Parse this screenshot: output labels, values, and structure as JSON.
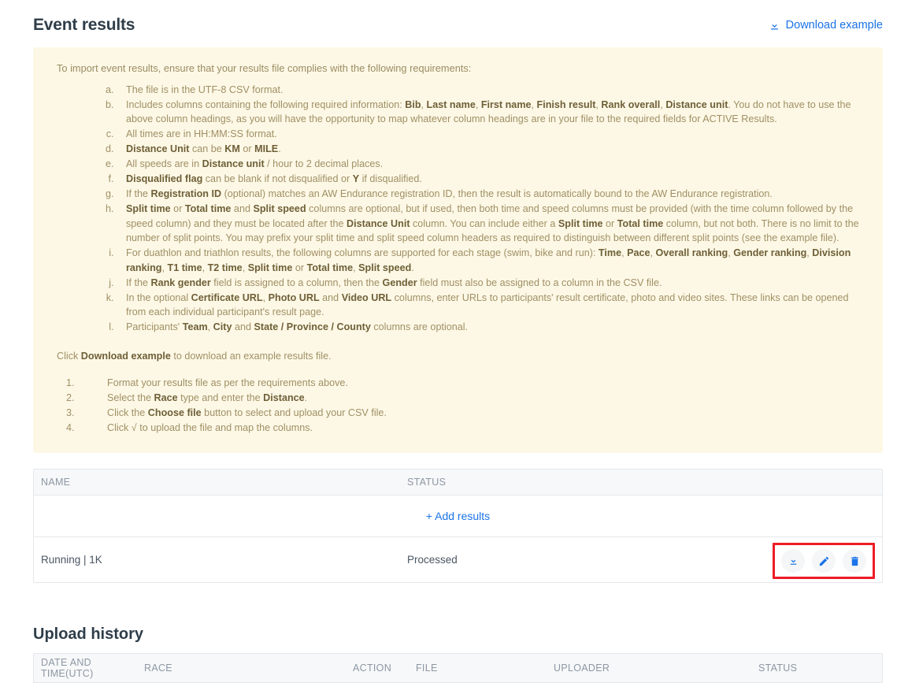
{
  "header": {
    "title": "Event results",
    "download_example_label": "Download example",
    "download_icon": "download-icon",
    "link_color": "#1a73e8"
  },
  "info_box": {
    "background_color": "#fdf8e6",
    "text_color": "#a08f64",
    "lead": "To import event results, ensure that your results file complies with the following requirements:",
    "requirements": [
      [
        {
          "t": "The file is in the UTF-8 CSV format.",
          "b": false
        }
      ],
      [
        {
          "t": "Includes columns containing the following required information: ",
          "b": false
        },
        {
          "t": "Bib",
          "b": true
        },
        {
          "t": ", ",
          "b": false
        },
        {
          "t": "Last name",
          "b": true
        },
        {
          "t": ", ",
          "b": false
        },
        {
          "t": "First name",
          "b": true
        },
        {
          "t": ", ",
          "b": false
        },
        {
          "t": "Finish result",
          "b": true
        },
        {
          "t": ", ",
          "b": false
        },
        {
          "t": "Rank overall",
          "b": true
        },
        {
          "t": ", ",
          "b": false
        },
        {
          "t": "Distance unit",
          "b": true
        },
        {
          "t": ". You do not have to use the above column headings, as you will have the opportunity to map whatever column headings are in your file to the required fields for ACTIVE Results.",
          "b": false
        }
      ],
      [
        {
          "t": "All times are in HH:MM:SS format.",
          "b": false
        }
      ],
      [
        {
          "t": "Distance Unit",
          "b": true
        },
        {
          "t": " can be ",
          "b": false
        },
        {
          "t": "KM",
          "b": true
        },
        {
          "t": " or ",
          "b": false
        },
        {
          "t": "MILE",
          "b": true
        },
        {
          "t": ".",
          "b": false
        }
      ],
      [
        {
          "t": "All speeds are in ",
          "b": false
        },
        {
          "t": "Distance unit",
          "b": true
        },
        {
          "t": " / hour to 2 decimal places.",
          "b": false
        }
      ],
      [
        {
          "t": "Disqualified flag",
          "b": true
        },
        {
          "t": " can be blank if not disqualified or ",
          "b": false
        },
        {
          "t": "Y",
          "b": true
        },
        {
          "t": " if disqualified.",
          "b": false
        }
      ],
      [
        {
          "t": "If the ",
          "b": false
        },
        {
          "t": "Registration ID",
          "b": true
        },
        {
          "t": " (optional) matches an AW Endurance registration ID, then the result is automatically bound to the AW Endurance registration.",
          "b": false
        }
      ],
      [
        {
          "t": "Split time",
          "b": true
        },
        {
          "t": " or ",
          "b": false
        },
        {
          "t": "Total time",
          "b": true
        },
        {
          "t": " and ",
          "b": false
        },
        {
          "t": "Split speed",
          "b": true
        },
        {
          "t": " columns are optional, but if used, then both time and speed columns must be provided (with the time column followed by the speed column) and they must be located after the ",
          "b": false
        },
        {
          "t": "Distance Unit",
          "b": true
        },
        {
          "t": " column. You can include either a ",
          "b": false
        },
        {
          "t": "Split time",
          "b": true
        },
        {
          "t": " or ",
          "b": false
        },
        {
          "t": "Total time",
          "b": true
        },
        {
          "t": " column, but not both. There is no limit to the number of split points. You may prefix your split time and split speed column headers as required to distinguish between different split points (see the example file).",
          "b": false
        }
      ],
      [
        {
          "t": "For duathlon and triathlon results, the following columns are supported for each stage (swim, bike and run): ",
          "b": false
        },
        {
          "t": "Time",
          "b": true
        },
        {
          "t": ", ",
          "b": false
        },
        {
          "t": "Pace",
          "b": true
        },
        {
          "t": ", ",
          "b": false
        },
        {
          "t": "Overall ranking",
          "b": true
        },
        {
          "t": ", ",
          "b": false
        },
        {
          "t": "Gender ranking",
          "b": true
        },
        {
          "t": ", ",
          "b": false
        },
        {
          "t": "Division ranking",
          "b": true
        },
        {
          "t": ", ",
          "b": false
        },
        {
          "t": "T1 time",
          "b": true
        },
        {
          "t": ", ",
          "b": false
        },
        {
          "t": "T2 time",
          "b": true
        },
        {
          "t": ", ",
          "b": false
        },
        {
          "t": "Split time",
          "b": true
        },
        {
          "t": " or ",
          "b": false
        },
        {
          "t": "Total time",
          "b": true
        },
        {
          "t": ", ",
          "b": false
        },
        {
          "t": "Split speed",
          "b": true
        },
        {
          "t": ".",
          "b": false
        }
      ],
      [
        {
          "t": "If the ",
          "b": false
        },
        {
          "t": "Rank gender",
          "b": true
        },
        {
          "t": " field is assigned to a column, then the ",
          "b": false
        },
        {
          "t": "Gender",
          "b": true
        },
        {
          "t": " field must also be assigned to a column in the CSV file.",
          "b": false
        }
      ],
      [
        {
          "t": "In the optional ",
          "b": false
        },
        {
          "t": "Certificate URL",
          "b": true
        },
        {
          "t": ", ",
          "b": false
        },
        {
          "t": "Photo URL",
          "b": true
        },
        {
          "t": " and ",
          "b": false
        },
        {
          "t": "Video URL",
          "b": true
        },
        {
          "t": " columns, enter URLs to participants' result certificate, photo and video sites. These links can be opened from each individual participant's result page.",
          "b": false
        }
      ],
      [
        {
          "t": "Participants' ",
          "b": false
        },
        {
          "t": "Team",
          "b": true
        },
        {
          "t": ", ",
          "b": false
        },
        {
          "t": "City",
          "b": true
        },
        {
          "t": " and ",
          "b": false
        },
        {
          "t": "State / Province / County",
          "b": true
        },
        {
          "t": " columns are optional.",
          "b": false
        }
      ]
    ],
    "closing": [
      {
        "t": "Click ",
        "b": false
      },
      {
        "t": "Download example",
        "b": true
      },
      {
        "t": " to download an example results file.",
        "b": false
      }
    ],
    "steps": [
      [
        {
          "t": "Format your results file as per the requirements above.",
          "b": false
        }
      ],
      [
        {
          "t": "Select the ",
          "b": false
        },
        {
          "t": "Race",
          "b": true
        },
        {
          "t": " type and enter the ",
          "b": false
        },
        {
          "t": "Distance",
          "b": true
        },
        {
          "t": ".",
          "b": false
        }
      ],
      [
        {
          "t": "Click the ",
          "b": false
        },
        {
          "t": "Choose file",
          "b": true
        },
        {
          "t": " button to select and upload your CSV file.",
          "b": false
        }
      ],
      [
        {
          "t": "Click √  to upload the file and map the columns.",
          "b": false
        }
      ]
    ]
  },
  "results_table": {
    "columns": [
      "NAME",
      "STATUS"
    ],
    "add_results_label": "+ Add results",
    "rows": [
      {
        "name": "Running | 1K",
        "status": "Processed",
        "actions": [
          "download-icon",
          "edit-icon",
          "delete-icon"
        ]
      }
    ],
    "highlight_color": "#ee1c25",
    "icon_color": "#1a73e8"
  },
  "upload_history": {
    "title": "Upload history",
    "columns": [
      "DATE AND TIME(UTC)",
      "RACE",
      "ACTION",
      "FILE",
      "UPLOADER",
      "STATUS"
    ]
  }
}
